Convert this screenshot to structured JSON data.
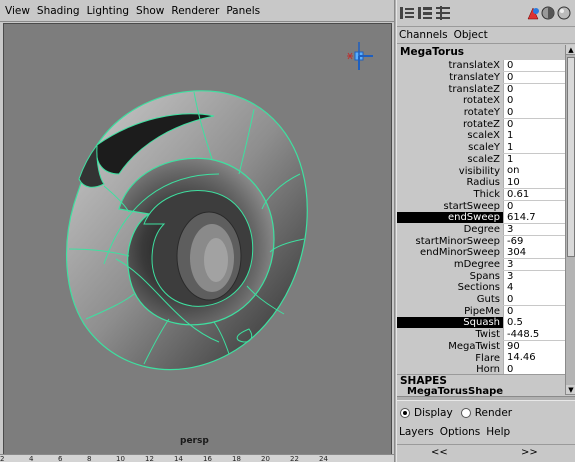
{
  "viewport": {
    "menu": [
      "View",
      "Shading",
      "Lighting",
      "Show",
      "Renderer",
      "Panels"
    ],
    "camera": "persp",
    "ruler_ticks": [
      "2",
      "4",
      "6",
      "8",
      "10",
      "12",
      "14",
      "16",
      "18",
      "20",
      "22",
      "24"
    ]
  },
  "channel_box": {
    "toolbar_icons": [
      "channel-box-icon",
      "layer-editor-icon",
      "channel-layer-icon",
      "tool-settings-icon",
      "render-sphere-icon",
      "sphere-icon"
    ],
    "menu": [
      "Channels",
      "Object"
    ],
    "node_name": "MegaTorus",
    "attributes": [
      {
        "label": "translateX",
        "value": "0"
      },
      {
        "label": "translateY",
        "value": "0"
      },
      {
        "label": "translateZ",
        "value": "0"
      },
      {
        "label": "rotateX",
        "value": "0"
      },
      {
        "label": "rotateY",
        "value": "0"
      },
      {
        "label": "rotateZ",
        "value": "0"
      },
      {
        "label": "scaleX",
        "value": "1"
      },
      {
        "label": "scaleY",
        "value": "1"
      },
      {
        "label": "scaleZ",
        "value": "1"
      },
      {
        "label": "visibility",
        "value": "on"
      },
      {
        "label": "Radius",
        "value": "10"
      },
      {
        "label": "Thick",
        "value": "0.61"
      },
      {
        "label": "startSweep",
        "value": "0"
      },
      {
        "label": "endSweep",
        "value": "614.7",
        "highlighted": true
      },
      {
        "label": "Degree",
        "value": "3"
      },
      {
        "label": "startMinorSweep",
        "value": "-69"
      },
      {
        "label": "endMinorSweep",
        "value": "304"
      },
      {
        "label": "mDegree",
        "value": "3"
      },
      {
        "label": "Spans",
        "value": "3"
      },
      {
        "label": "Sections",
        "value": "4"
      },
      {
        "label": "Guts",
        "value": "0"
      },
      {
        "label": "PipeMe",
        "value": "0"
      },
      {
        "label": "Squash",
        "value": "0.5",
        "highlighted": true
      },
      {
        "label": "Twist",
        "value": "-448.5"
      },
      {
        "label": "MegaTwist",
        "value": "90"
      },
      {
        "label": "Flare",
        "value": "14.46"
      },
      {
        "label": "Horn",
        "value": "0"
      }
    ],
    "shapes_title": "SHAPES",
    "shape_node": "MegaTorusShape"
  },
  "layer_editor": {
    "display_label": "Display",
    "render_label": "Render",
    "display_selected": true,
    "menu": [
      "Layers",
      "Options",
      "Help"
    ],
    "nav_left": "<<",
    "nav_right": ">>"
  },
  "colors": {
    "viewport_bg": "#7d7d7d",
    "wireframe": "#3ee0a0",
    "panel_bg": "#c8c8c8"
  }
}
